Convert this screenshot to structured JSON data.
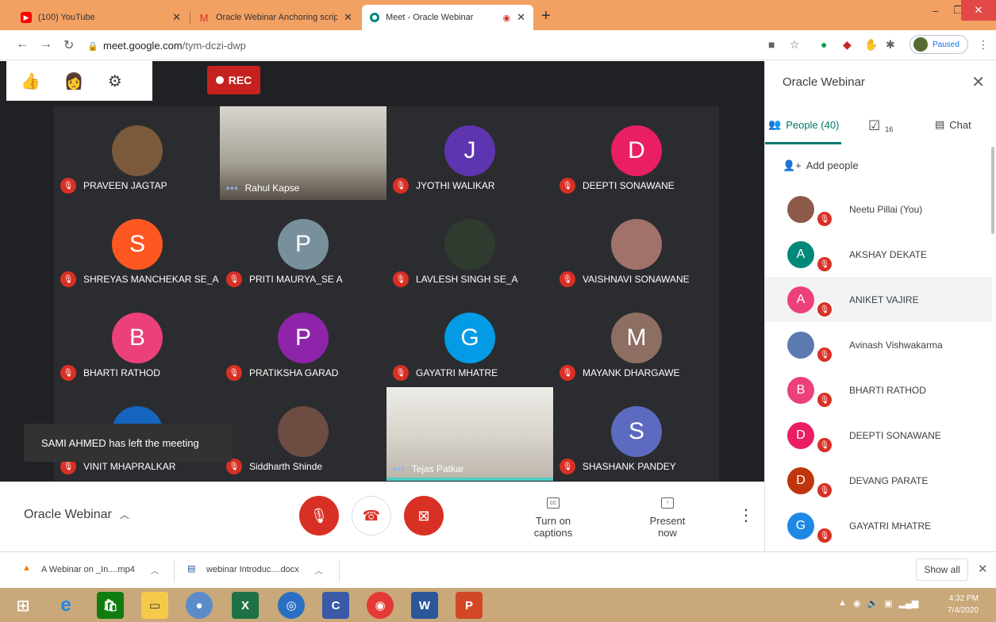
{
  "browser": {
    "tabs": [
      {
        "title": "(100) YouTube",
        "icon": "youtube-icon",
        "color": "#ff0000"
      },
      {
        "title": "Oracle Webinar Anchoring script",
        "icon": "gmail-icon",
        "color": "#d93025"
      },
      {
        "title": "Meet - Oracle Webinar",
        "icon": "meet-icon",
        "color": "#00897b"
      }
    ],
    "url_host": "meet.google.com",
    "url_path": "/tym-dczi-dwp",
    "profile_status": "Paused"
  },
  "meet": {
    "rec_label": "REC",
    "toast": "SAMI AHMED has left the meeting",
    "tiles": [
      {
        "name": "PRAVEEN JAGTAP",
        "initial": "",
        "color": "#7a5a3a"
      },
      {
        "name": "Rahul Kapse",
        "initial": "",
        "color": "#8a8a80"
      },
      {
        "name": "JYOTHI WALIKAR",
        "initial": "J",
        "color": "#5e35b1"
      },
      {
        "name": "DEEPTI SONAWANE",
        "initial": "D",
        "color": "#e91e63"
      },
      {
        "name": "SHREYAS MANCHEKAR SE_A",
        "initial": "S",
        "color": "#ff5722"
      },
      {
        "name": "PRITI MAURYA_SE A",
        "initial": "P",
        "color": "#78909c"
      },
      {
        "name": "LAVLESH SINGH SE_A",
        "initial": "",
        "color": "#2e3b2e"
      },
      {
        "name": "VAISHNAVI SONAWANE",
        "initial": "",
        "color": "#a0726a"
      },
      {
        "name": "BHARTI RATHOD",
        "initial": "B",
        "color": "#ec407a"
      },
      {
        "name": "PRATIKSHA GARAD",
        "initial": "P",
        "color": "#8e24aa"
      },
      {
        "name": "GAYATRI MHATRE",
        "initial": "G",
        "color": "#039be5"
      },
      {
        "name": "MAYANK DHARGAWE",
        "initial": "M",
        "color": "#8d6e63"
      },
      {
        "name": "VINIT MHAPRALKAR",
        "initial": "",
        "color": "#1565c0"
      },
      {
        "name": "Siddharth Shinde",
        "initial": "",
        "color": "#6d4c41"
      },
      {
        "name": "Tejas Patkar",
        "initial": "",
        "color": "#cfc9c0"
      },
      {
        "name": "SHASHANK PANDEY",
        "initial": "S",
        "color": "#5c6bc0"
      }
    ],
    "meeting_title": "Oracle Webinar",
    "captions_label": "Turn on captions",
    "present_label": "Present now"
  },
  "panel": {
    "title": "Oracle Webinar",
    "people_tab": "People (40)",
    "tasks_count": "16",
    "chat_tab": "Chat",
    "add_people": "Add people",
    "people": [
      {
        "name": "Neetu Pillai (You)",
        "initial": "",
        "color": "#8d5a4a"
      },
      {
        "name": "AKSHAY DEKATE",
        "initial": "A",
        "color": "#00897b"
      },
      {
        "name": "ANIKET VAJIRE",
        "initial": "A",
        "color": "#ec407a"
      },
      {
        "name": "Avinash Vishwakarma",
        "initial": "",
        "color": "#5a7ab0"
      },
      {
        "name": "BHARTI RATHOD",
        "initial": "B",
        "color": "#ec407a"
      },
      {
        "name": "DEEPTI SONAWANE",
        "initial": "D",
        "color": "#e91e63"
      },
      {
        "name": "DEVANG PARATE",
        "initial": "D",
        "color": "#bf360c"
      },
      {
        "name": "GAYATRI MHATRE",
        "initial": "G",
        "color": "#1e88e5"
      }
    ]
  },
  "downloads": {
    "items": [
      "A Webinar on _In....mp4",
      "webinar Introduc....docx"
    ],
    "show_all": "Show all"
  },
  "taskbar": {
    "time": "4:32 PM",
    "date": "7/4/2020"
  }
}
